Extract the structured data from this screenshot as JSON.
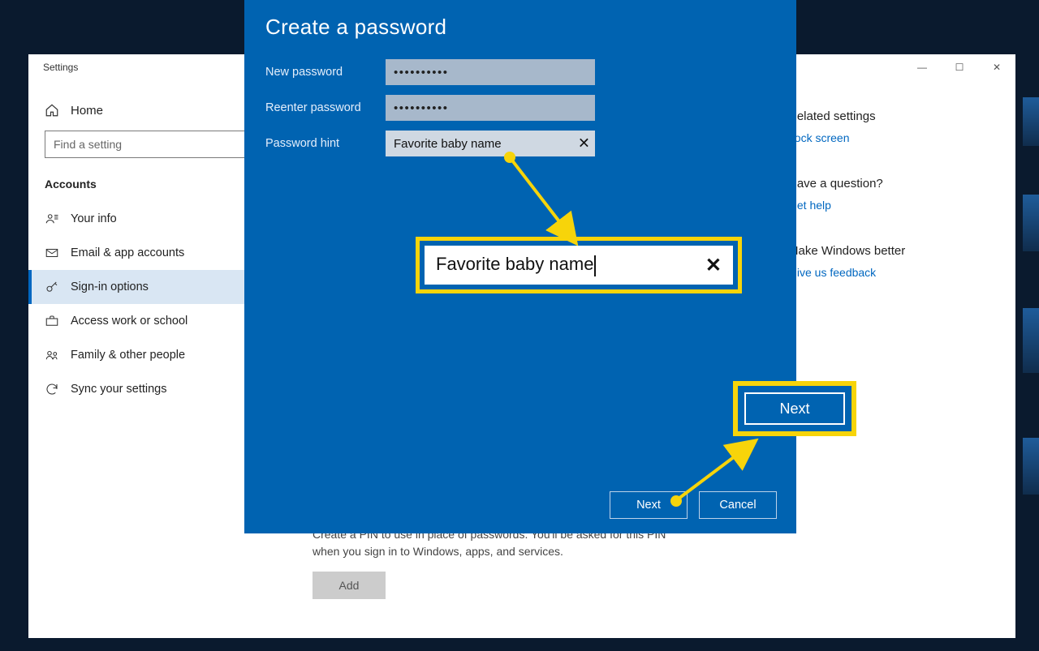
{
  "settings": {
    "title": "Settings",
    "home": "Home",
    "search_placeholder": "Find a setting",
    "section": "Accounts",
    "nav": [
      {
        "label": "Your info",
        "icon": "user"
      },
      {
        "label": "Email & app accounts",
        "icon": "mail"
      },
      {
        "label": "Sign-in options",
        "icon": "key",
        "selected": true
      },
      {
        "label": "Access work or school",
        "icon": "briefcase"
      },
      {
        "label": "Family & other people",
        "icon": "people"
      },
      {
        "label": "Sync your settings",
        "icon": "sync"
      }
    ],
    "pin_desc": "Create a PIN to use in place of passwords. You'll be asked for this PIN when you sign in to Windows, apps, and services.",
    "add_label": "Add",
    "right": {
      "related_heading": "Related settings",
      "related_link": "Lock screen",
      "question_heading": "Have a question?",
      "question_link": "Get help",
      "better_heading": "Make Windows better",
      "better_link": "Give us feedback"
    },
    "window_controls": {
      "min": "—",
      "max": "☐",
      "close": "✕"
    }
  },
  "modal": {
    "title": "Create a password",
    "labels": {
      "new": "New password",
      "reenter": "Reenter password",
      "hint": "Password hint"
    },
    "values": {
      "new": "••••••••••",
      "reenter": "••••••••••",
      "hint": "Favorite baby name"
    },
    "buttons": {
      "next": "Next",
      "cancel": "Cancel"
    }
  },
  "callout": {
    "hint_zoom": "Favorite baby name",
    "next_zoom": "Next"
  }
}
